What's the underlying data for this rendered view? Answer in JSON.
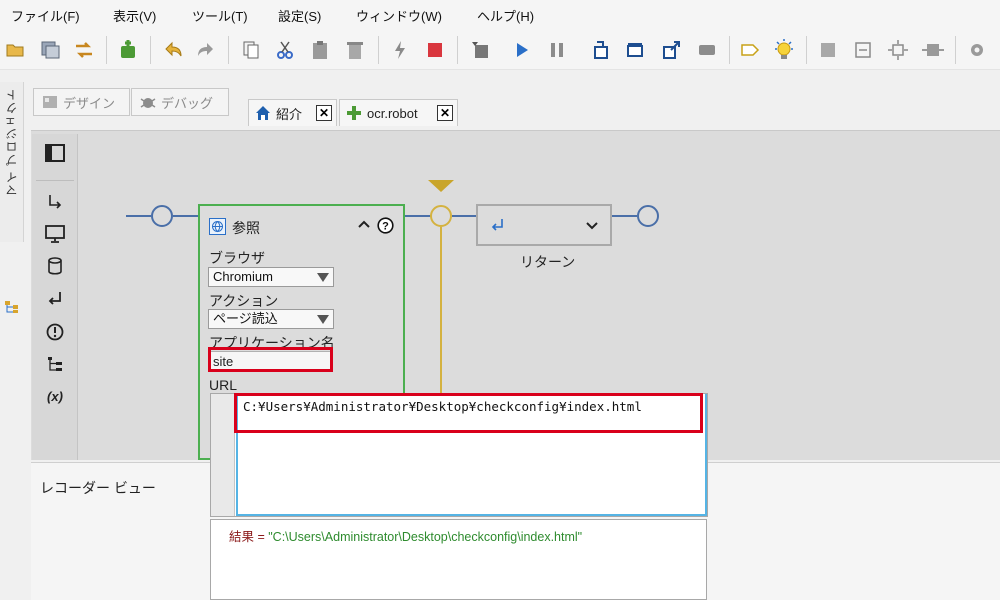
{
  "menu": [
    {
      "label": "ファイル(F)",
      "name": "menu-file"
    },
    {
      "label": "表示(V)",
      "name": "menu-view"
    },
    {
      "label": "ツール(T)",
      "name": "menu-tools"
    },
    {
      "label": "設定(S)",
      "name": "menu-settings"
    },
    {
      "label": "ウィンドウ(W)",
      "name": "menu-window"
    },
    {
      "label": "ヘルプ(H)",
      "name": "menu-help"
    }
  ],
  "side_tab": {
    "label": "マイ プロジェクト"
  },
  "mode_buttons": {
    "design": "デザイン",
    "debug": "デバッグ"
  },
  "tabs": [
    {
      "label": "紹介",
      "icon": "home-icon"
    },
    {
      "label": "ocr.robot",
      "icon": "robot-icon"
    }
  ],
  "palette": [
    "step-into-icon",
    "monitor-icon",
    "database-icon",
    "return-icon",
    "alert-icon",
    "tree-icon",
    "variable-icon"
  ],
  "palette_variable_label": "(x)",
  "browse_card": {
    "title": "参照",
    "browser_label": "ブラウザ",
    "browser_value": "Chromium",
    "action_label": "アクション",
    "action_value": "ページ読込",
    "app_name_label": "アプリケーション名",
    "app_name_value": "site",
    "url_label": "URL"
  },
  "return_card": {
    "label": "リターン"
  },
  "url_editor": {
    "value": "C:¥Users¥Administrator¥Desktop¥checkconfig¥index.html"
  },
  "result": {
    "prefix": "結果 = ",
    "value": "\"C:\\Users\\Administrator\\Desktop\\checkconfig\\index.html\""
  },
  "recorder": {
    "title": "レコーダー ビュー"
  },
  "colors": {
    "accent_blue": "#4a6fa8",
    "card_green": "#4caf50",
    "highlight_red": "#d9001b",
    "editor_focus": "#55b4e5",
    "string_green": "#2e8b2e",
    "result_prefix": "#8b1a1a",
    "merge_gold": "#d4b240"
  }
}
